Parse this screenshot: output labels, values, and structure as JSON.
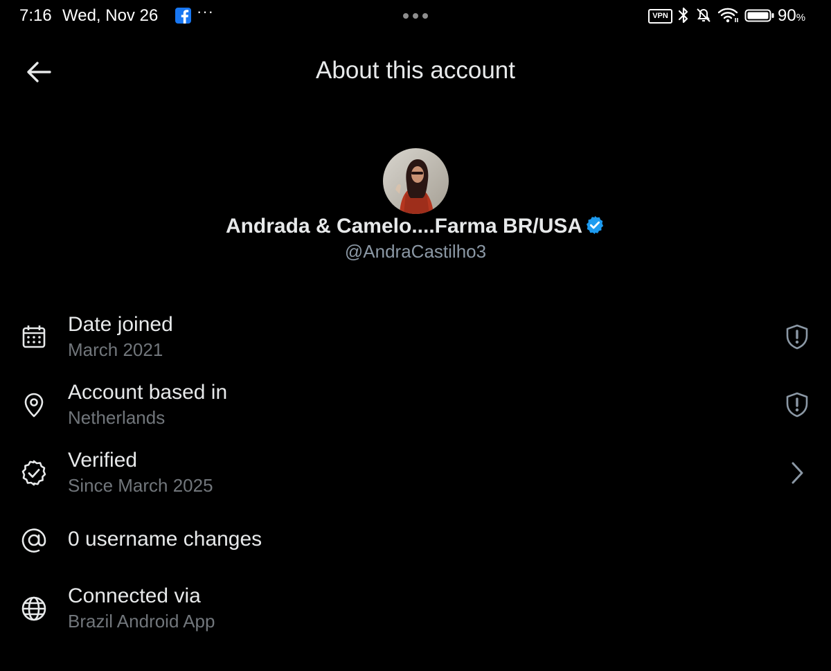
{
  "status_bar": {
    "time": "7:16",
    "date": "Wed, Nov 26",
    "more_glyph": "···",
    "vpn_label": "VPN",
    "battery_value": "90",
    "battery_unit": "%",
    "icons": [
      "facebook-icon",
      "vpn-icon",
      "bluetooth-icon",
      "bell-muted-icon",
      "wifi-icon",
      "battery-icon"
    ]
  },
  "header": {
    "title": "About this account",
    "back_icon": "arrow-left-icon"
  },
  "profile": {
    "name": "Andrada & Camelo....Farma BR/USA",
    "handle": "@AndraCastilho3",
    "verified_badge_color": "#1d9bf0"
  },
  "details": [
    {
      "icon": "calendar-icon",
      "label": "Date joined",
      "value": "March 2021",
      "trailing_icon": "shield-alert-icon"
    },
    {
      "icon": "location-pin-icon",
      "label": "Account based in",
      "value": "Netherlands",
      "trailing_icon": "shield-alert-icon"
    },
    {
      "icon": "verified-badge-outline-icon",
      "label": "Verified",
      "value": "Since March 2025",
      "trailing_icon": "chevron-right-icon"
    },
    {
      "icon": "at-sign-icon",
      "label": "0 username changes"
    },
    {
      "icon": "globe-icon",
      "label": "Connected via",
      "value": "Brazil Android App"
    }
  ],
  "colors": {
    "background": "#000000",
    "primary_text": "#e7e9ea",
    "secondary_text": "#71767b",
    "accent": "#1d9bf0"
  }
}
